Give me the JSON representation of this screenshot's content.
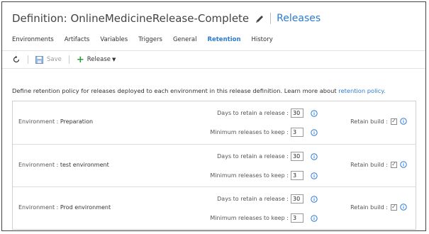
{
  "header": {
    "title": "Definition: OnlineMedicineRelease-Complete",
    "link": "Releases"
  },
  "tabs": [
    {
      "label": "Environments",
      "active": false
    },
    {
      "label": "Artifacts",
      "active": false
    },
    {
      "label": "Variables",
      "active": false
    },
    {
      "label": "Triggers",
      "active": false
    },
    {
      "label": "General",
      "active": false
    },
    {
      "label": "Retention",
      "active": true
    },
    {
      "label": "History",
      "active": false
    }
  ],
  "toolbar": {
    "refresh_icon": "refresh-icon",
    "save_label": "Save",
    "release_label": "Release"
  },
  "description": {
    "text": "Define retention policy for releases deployed to each environment in this release definition. Learn more about ",
    "link": "retention policy."
  },
  "environments": [
    {
      "prefix": "Environment : ",
      "name": "Preparation",
      "days_label": "Days to retain a release :",
      "days": "30",
      "min_label": "Minimum releases to keep :",
      "min": "3",
      "retain_label": "Retain build :",
      "retain_build": true
    },
    {
      "prefix": "Environment : ",
      "name": "test environment",
      "days_label": "Days to retain a release :",
      "days": "30",
      "min_label": "Minimum releases to keep :",
      "min": "3",
      "retain_label": "Retain build :",
      "retain_build": true
    },
    {
      "prefix": "Environment : ",
      "name": "Prod environment",
      "days_label": "Days to retain a release :",
      "days": "30",
      "min_label": "Minimum releases to keep :",
      "min": "3",
      "retain_label": "Retain build :",
      "retain_build": true
    }
  ],
  "colors": {
    "accent": "#2b7bd3",
    "add": "#2a9d3a"
  }
}
